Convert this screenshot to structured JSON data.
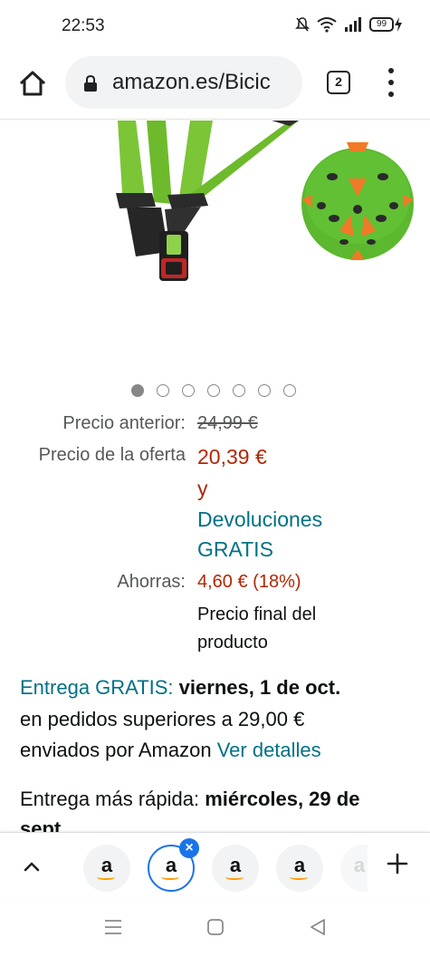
{
  "status_bar": {
    "time": "22:53",
    "battery": "99",
    "icons": [
      "mute-icon",
      "wifi-icon",
      "signal-icon",
      "battery-icon",
      "charging-icon"
    ]
  },
  "browser": {
    "url": "amazon.es/Bicic",
    "tab_count": "2",
    "icons": [
      "home-icon",
      "lock-icon",
      "menu-icon"
    ]
  },
  "carousel": {
    "total_dots": 7,
    "active_index": 0
  },
  "price": {
    "previous_label": "Precio anterior:",
    "previous_value": "24,99 €",
    "deal_label": "Precio de la oferta",
    "deal_value": "20,39 €",
    "and_word": "y",
    "returns_line1": "Devoluciones",
    "returns_line2": "GRATIS",
    "savings_label": "Ahorras:",
    "savings_value": "4,60 € (18%)",
    "final_note_line1": "Precio final del",
    "final_note_line2": "producto"
  },
  "delivery": {
    "free_label": "Entrega GRATIS:",
    "free_date": "viernes, 1 de oct.",
    "condition": "en pedidos superiores a 29,00 €",
    "shipped_by": "enviados por Amazon",
    "details_link": "Ver detalles",
    "fast_label": "Entrega más rápida:",
    "fast_date": "miércoles, 29 de",
    "fast_date_cont": "sept."
  },
  "tab_strip": {
    "favicon_letter": "a",
    "close_glyph": "×",
    "tabs": 5
  },
  "colors": {
    "price_red": "#b12704",
    "link_teal": "#007185",
    "tab_selected": "#1a73e8",
    "amazon_orange": "#ff9900",
    "helmet_green": "#5cb82e"
  }
}
